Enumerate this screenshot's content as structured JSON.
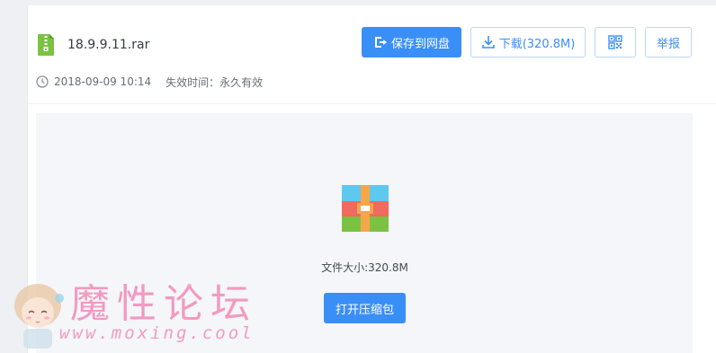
{
  "file": {
    "name": "18.9.9.11.rar",
    "icon": "zip-file-icon",
    "date": "2018-09-09 10:14",
    "expire_label": "失效时间：永久有效"
  },
  "toolbar": {
    "save_label": "保存到网盘",
    "download_label": "下载(320.8M)",
    "qr_icon": "qr-code-icon",
    "report_label": "举报"
  },
  "preview": {
    "icon": "archive-box-icon",
    "size_label": "文件大小:320.8M",
    "open_label": "打开压缩包"
  },
  "watermark": {
    "title": "魔性论坛",
    "url": "www.moxing.cool"
  },
  "colors": {
    "accent": "#3a8ff7",
    "file_icon": "#7cc242",
    "watermark": "#f28ab8"
  }
}
